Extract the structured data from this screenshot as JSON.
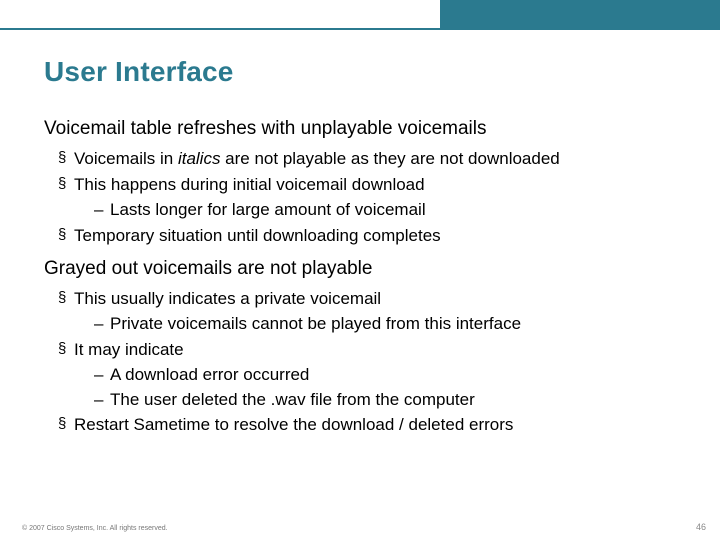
{
  "title": "User Interface",
  "section1": {
    "heading": "Voicemail table refreshes with unplayable voicemails",
    "b1_pre": "Voicemails in ",
    "b1_em": "italics",
    "b1_post": " are not playable as they are not downloaded",
    "b2": "This happens during initial voicemail download",
    "b2_d1": "Lasts longer for large amount of voicemail",
    "b3": "Temporary situation until downloading completes"
  },
  "section2": {
    "heading": "Grayed out voicemails are not playable",
    "b1": "This usually indicates a private voicemail",
    "b1_d1": "Private voicemails cannot be played from this interface",
    "b2": "It may indicate",
    "b2_d1": "A download error occurred",
    "b2_d2": "The user deleted the .wav file from the computer",
    "b3": "Restart Sametime to resolve the download / deleted errors"
  },
  "footer": "© 2007 Cisco Systems, Inc. All rights reserved.",
  "pagenum": "46"
}
